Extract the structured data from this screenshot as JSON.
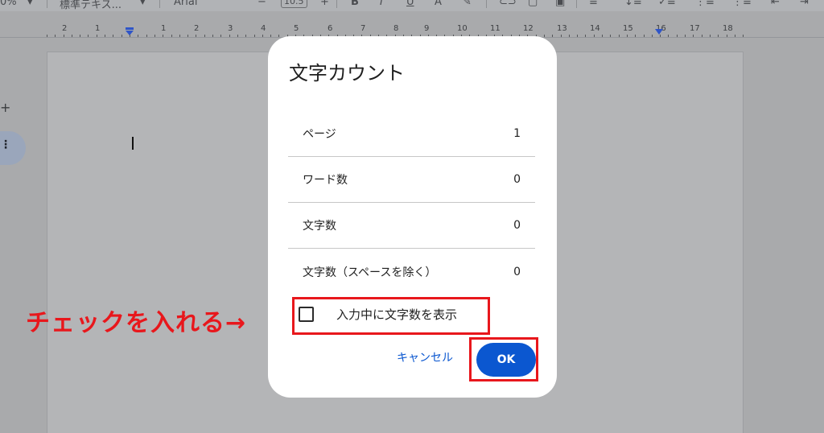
{
  "toolbar": {
    "zoom": "0%",
    "style": "標準テキス...",
    "font": "Arial",
    "font_size": "10.5"
  },
  "ruler": {
    "numbers": [
      "2",
      "1",
      "1",
      "2",
      "3",
      "4",
      "5",
      "6",
      "7",
      "8",
      "9",
      "10",
      "11",
      "12",
      "13",
      "14",
      "15",
      "16",
      "17",
      "18"
    ]
  },
  "dialog": {
    "title": "文字カウント",
    "stats": [
      {
        "label": "ページ",
        "value": "1"
      },
      {
        "label": "ワード数",
        "value": "0"
      },
      {
        "label": "文字数",
        "value": "0"
      },
      {
        "label": "文字数（スペースを除く）",
        "value": "0"
      }
    ],
    "checkbox_label": "入力中に文字数を表示",
    "checkbox_checked": false,
    "cancel_label": "キャンセル",
    "ok_label": "OK"
  },
  "annotation": {
    "text": "チェックを入れる→",
    "color": "#e8171c"
  },
  "colors": {
    "accent": "#0b57d0",
    "overlay": "#a9aaac"
  }
}
